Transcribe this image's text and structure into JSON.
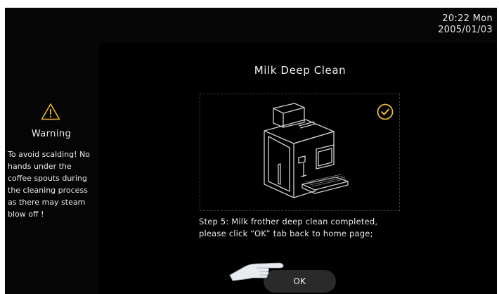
{
  "status": {
    "time": "20:22 Mon",
    "date": "2005/01/03"
  },
  "warning": {
    "icon": "warning-triangle-icon",
    "title": "Warning",
    "message": "To avoid scalding! No hands under the coffee spouts during the cleaning process as there may steam blow off !"
  },
  "main": {
    "title": "Milk Deep Clean",
    "illustration_icon": "coffee-machine-icon",
    "status_icon": "check-circle-icon",
    "step_line1": "Step 5: Milk frother deep clean completed,",
    "step_line2": "please click “OK” tab back to home page;",
    "ok_label": "OK",
    "pointer_icon": "pointing-hand-icon"
  },
  "colors": {
    "accent": "#e8b830",
    "background": "#000000",
    "text": "#e9e9e9",
    "button": "#2a2a2a"
  }
}
